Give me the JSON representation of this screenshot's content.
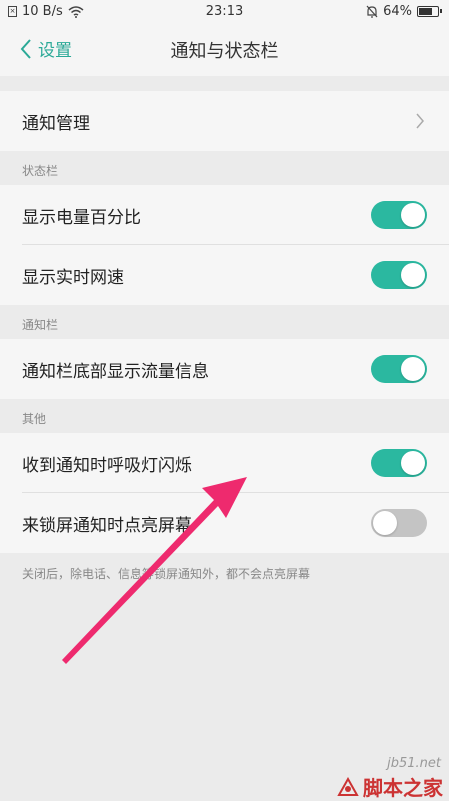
{
  "status_bar": {
    "sim_glyph": "×",
    "speed": "10 B/s",
    "time": "23:13",
    "battery": "64%",
    "icons": [
      "sim-icon",
      "wifi-icon",
      "mute-bell-icon",
      "battery-icon"
    ]
  },
  "nav": {
    "back_label": "设置",
    "title": "通知与状态栏"
  },
  "rows": {
    "notification_management": "通知管理",
    "show_battery_percent": "显示电量百分比",
    "show_network_speed": "显示实时网速",
    "show_traffic_info": "通知栏底部显示流量信息",
    "breathing_light": "收到通知时呼吸灯闪烁",
    "lockscreen_wake": "来锁屏通知时点亮屏幕"
  },
  "toggles": {
    "show_battery_percent": true,
    "show_network_speed": true,
    "show_traffic_info": true,
    "breathing_light": true,
    "lockscreen_wake": false
  },
  "sections": {
    "status_bar": "状态栏",
    "notification_bar": "通知栏",
    "other": "其他"
  },
  "footnote": "关闭后，除电话、信息等锁屏通知外，都不会点亮屏幕",
  "watermark": {
    "url": "jb51.net",
    "brand": "脚本之家"
  },
  "colors": {
    "accent": "#2ba997",
    "toggle_on": "#2bb8a0",
    "toggle_off": "#c4c4c4",
    "annotation_arrow": "#ee2a6e"
  }
}
